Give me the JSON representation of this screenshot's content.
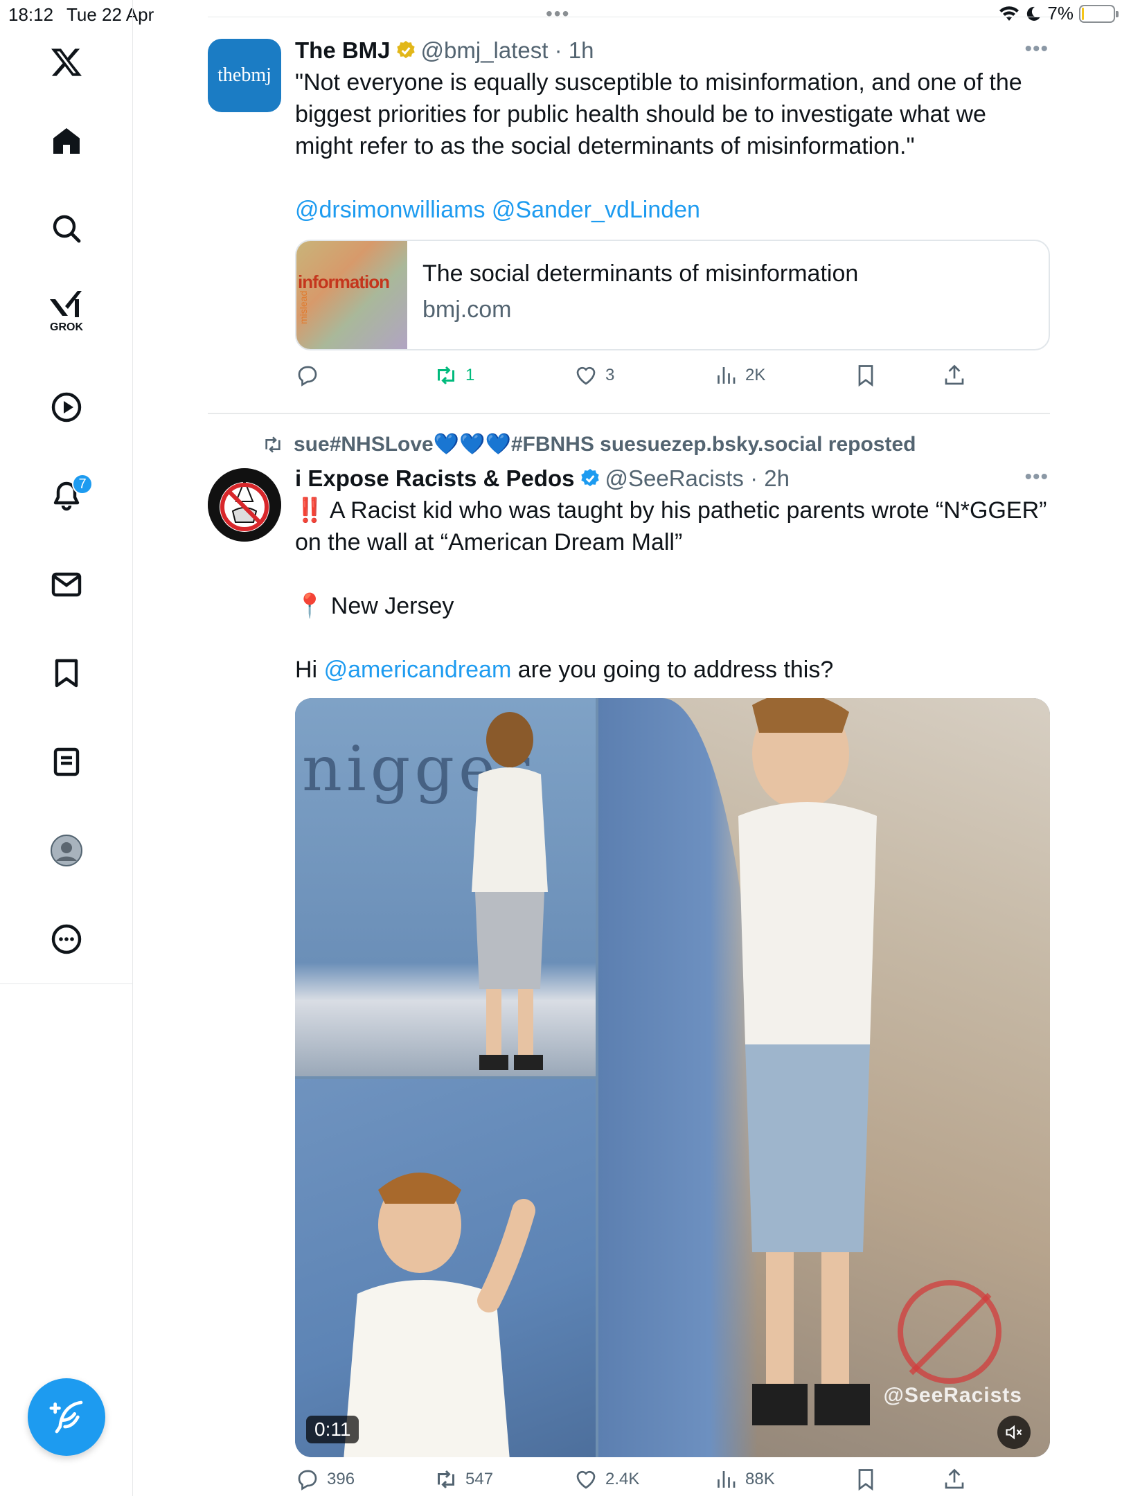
{
  "status_bar": {
    "time": "18:12",
    "date": "Tue 22 Apr",
    "battery": "7%"
  },
  "sidebar": {
    "items": [
      {
        "name": "x-logo",
        "icon": "x-logo-icon"
      },
      {
        "name": "home",
        "icon": "home-icon"
      },
      {
        "name": "explore",
        "icon": "search-icon"
      },
      {
        "name": "grok",
        "icon": "grok-icon",
        "label": "GROK"
      },
      {
        "name": "video",
        "icon": "play-icon"
      },
      {
        "name": "notifications",
        "icon": "bell-icon",
        "badge": "7"
      },
      {
        "name": "messages",
        "icon": "mail-icon"
      },
      {
        "name": "bookmarks",
        "icon": "bookmark-icon"
      },
      {
        "name": "lists",
        "icon": "list-icon"
      },
      {
        "name": "profile",
        "icon": "avatar-icon"
      },
      {
        "name": "more",
        "icon": "more-icon"
      }
    ],
    "compose_icon": "compose-icon"
  },
  "tweets": [
    {
      "avatar_text": "thebmj",
      "name": "The BMJ",
      "handle": "@bmj_latest",
      "time": "1h",
      "text_lines": [
        "\"Not everyone is equally susceptible to misinformation, and one of the biggest priorities for public health should be to investigate what we might refer to as the social determinants of misinformation.\""
      ],
      "mentions": "@drsimonwilliams @Sander_vdLinden",
      "card": {
        "title": "The social determinants of misinformation",
        "domain": "bmj.com",
        "thumb_word": "information",
        "thumb_word2": "mislead"
      },
      "actions": {
        "reply": "",
        "retweet": "1",
        "like": "3",
        "views": "2K"
      }
    },
    {
      "reposted_by": "sue#NHSLove",
      "reposted_hearts": "💙💙💙",
      "reposted_rest": "#FBNHS suesuezep.bsky.social reposted",
      "name": "i Expose Racists & Pedos",
      "handle": "@SeeRacists",
      "time": "2h",
      "line1_emoji": "‼️",
      "line1": "A Racist kid who was taught by his pathetic parents wrote “N*GGER” on the wall at “American Dream Mall”",
      "location_emoji": "📍",
      "location": "New Jersey",
      "line3_prefix": "Hi ",
      "line3_mention": "@americandream",
      "line3_suffix": " are you going to address this?",
      "media": {
        "duration": "0:11",
        "watermark": "@SeeRacists",
        "wall_text": "nigger"
      },
      "actions": {
        "reply": "396",
        "retweet": "547",
        "like": "2.4K",
        "views": "88K"
      }
    }
  ]
}
